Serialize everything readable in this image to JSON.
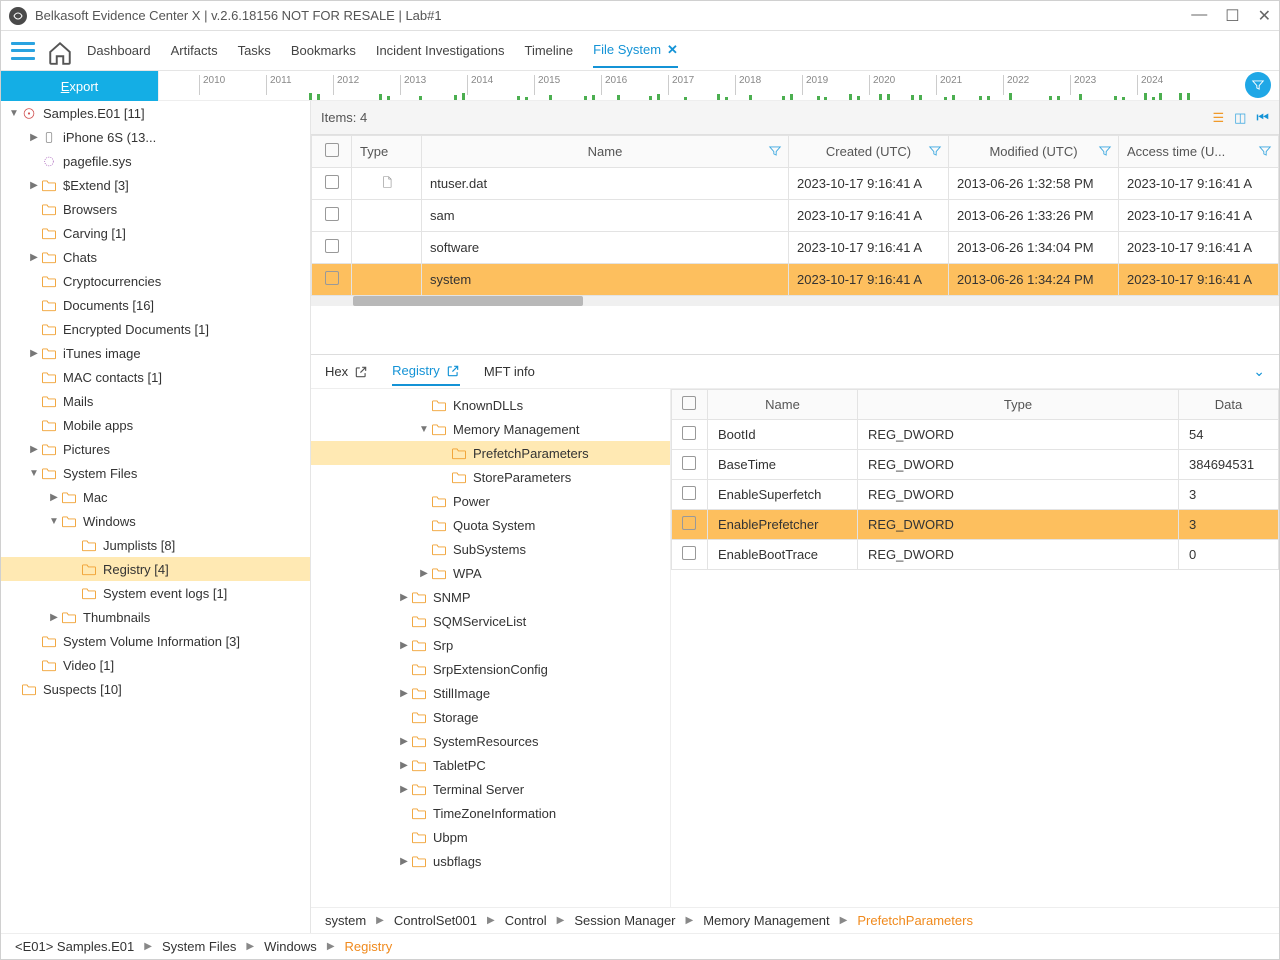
{
  "window_title": "Belkasoft Evidence Center X | v.2.6.18156 NOT FOR RESALE | Lab#1",
  "nav": {
    "dashboard": "Dashboard",
    "artifacts": "Artifacts",
    "tasks": "Tasks",
    "bookmarks": "Bookmarks",
    "incident": "Incident Investigations",
    "timeline": "Timeline",
    "filesystem": "File System"
  },
  "export_label": "Export",
  "timeline_years": [
    "2010",
    "2011",
    "2012",
    "2013",
    "2014",
    "2015",
    "2016",
    "2017",
    "2018",
    "2019",
    "2020",
    "2021",
    "2022",
    "2023",
    "2024"
  ],
  "sidebar": {
    "root": "<E01> Samples.E01 [11]",
    "itunes": "<iTunes10Encrypted> iPhone 6S (13...",
    "pagefile": "<Pagefile> pagefile.sys",
    "extend": "$Extend [3]",
    "browsers": "Browsers",
    "carving": "Carving [1]",
    "chats": "Chats",
    "crypto": "Cryptocurrencies",
    "documents": "Documents [16]",
    "encdocs": "Encrypted Documents [1]",
    "itunesimg": "iTunes image",
    "mac": "MAC contacts [1]",
    "mails": "Mails",
    "mobile": "Mobile apps",
    "pictures": "Pictures",
    "sysfiles": "System Files",
    "mac2": "Mac",
    "windows": "Windows",
    "jumplists": "Jumplists [8]",
    "registry": "Registry [4]",
    "syslogs": "System event logs [1]",
    "thumbs": "Thumbnails",
    "svi": "System Volume Information [3]",
    "video": "Video [1]",
    "suspects": "<LocalFolder> Suspects [10]"
  },
  "items_count": "Items: 4",
  "file_cols": {
    "type": "Type",
    "name": "Name",
    "created": "Created (UTC)",
    "modified": "Modified (UTC)",
    "access": "Access time (U..."
  },
  "files": [
    {
      "name": "ntuser.dat",
      "created": "2023-10-17 9:16:41 A",
      "modified": "2013-06-26 1:32:58 PM",
      "access": "2023-10-17 9:16:41 A",
      "icon": true
    },
    {
      "name": "sam",
      "created": "2023-10-17 9:16:41 A",
      "modified": "2013-06-26 1:33:26 PM",
      "access": "2023-10-17 9:16:41 A"
    },
    {
      "name": "software",
      "created": "2023-10-17 9:16:41 A",
      "modified": "2013-06-26 1:34:04 PM",
      "access": "2023-10-17 9:16:41 A"
    },
    {
      "name": "system",
      "created": "2023-10-17 9:16:41 A",
      "modified": "2013-06-26 1:34:24 PM",
      "access": "2023-10-17 9:16:41 A",
      "sel": true
    }
  ],
  "detail_tabs": {
    "hex": "Hex",
    "registry": "Registry",
    "mft": "MFT info"
  },
  "reg_tree": {
    "knowndlls": "KnownDLLs",
    "memmgmt": "Memory Management",
    "prefetch": "PrefetchParameters",
    "store": "StoreParameters",
    "power": "Power",
    "quota": "Quota System",
    "subsys": "SubSystems",
    "wpa": "WPA",
    "snmp": "SNMP",
    "sqm": "SQMServiceList",
    "srp": "Srp",
    "srpext": "SrpExtensionConfig",
    "still": "StillImage",
    "storage": "Storage",
    "sysres": "SystemResources",
    "tablet": "TabletPC",
    "terminal": "Terminal Server",
    "tz": "TimeZoneInformation",
    "ubpm": "Ubpm",
    "usbflags": "usbflags"
  },
  "reg_cols": {
    "name": "Name",
    "type": "Type",
    "data": "Data"
  },
  "reg_vals": [
    {
      "name": "BootId",
      "type": "REG_DWORD",
      "data": "54"
    },
    {
      "name": "BaseTime",
      "type": "REG_DWORD",
      "data": "384694531"
    },
    {
      "name": "EnableSuperfetch",
      "type": "REG_DWORD",
      "data": "3"
    },
    {
      "name": "EnablePrefetcher",
      "type": "REG_DWORD",
      "data": "3",
      "sel": true
    },
    {
      "name": "EnableBootTrace",
      "type": "REG_DWORD",
      "data": "0"
    }
  ],
  "bc1": [
    "system",
    "ControlSet001",
    "Control",
    "Session Manager",
    "Memory Management",
    "PrefetchParameters"
  ],
  "bc2": [
    "<E01> Samples.E01",
    "System Files",
    "Windows",
    "Registry"
  ]
}
